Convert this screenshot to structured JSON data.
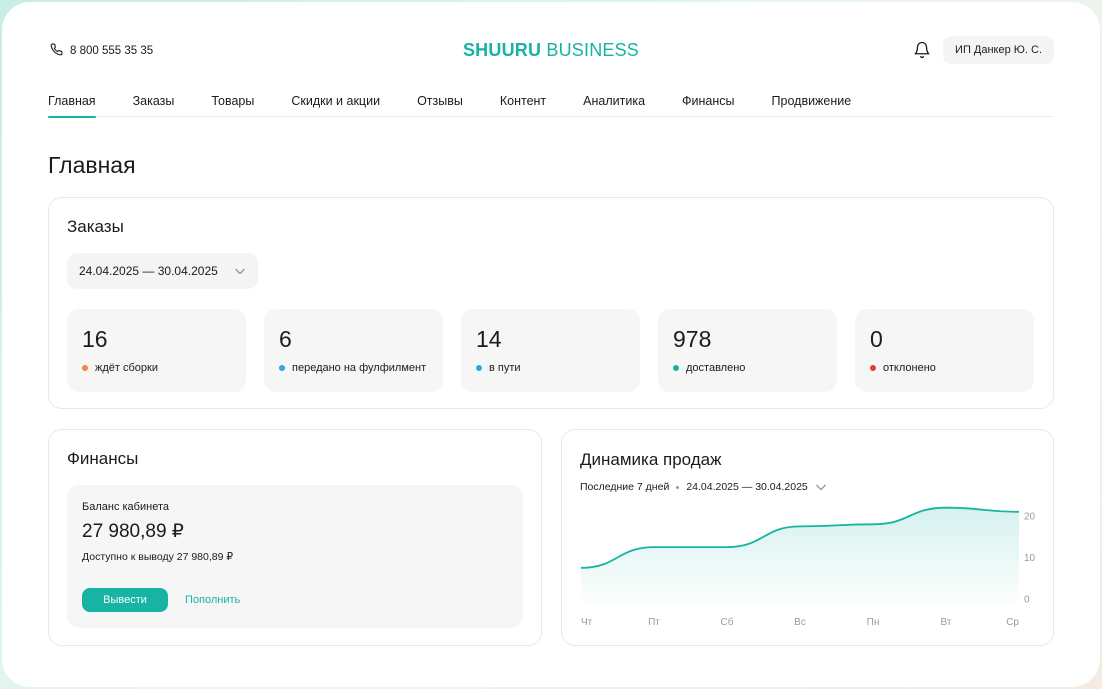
{
  "header": {
    "phone": "8 800 555 35 35",
    "logo_bold": "SHUURU",
    "logo_light": " BUSINESS",
    "account": "ИП Данкер Ю. С."
  },
  "nav": {
    "items": [
      "Главная",
      "Заказы",
      "Товары",
      "Скидки и акции",
      "Отзывы",
      "Контент",
      "Аналитика",
      "Финансы",
      "Продвижение"
    ],
    "active": "Главная"
  },
  "page_title": "Главная",
  "orders": {
    "title": "Заказы",
    "date_range": "24.04.2025 — 30.04.2025",
    "stats": [
      {
        "value": "16",
        "label": "ждёт сборки",
        "color": "#f5883b"
      },
      {
        "value": "6",
        "label": "передано на фулфилмент",
        "color": "#2fa6e8"
      },
      {
        "value": "14",
        "label": "в пути",
        "color": "#2fa6e8"
      },
      {
        "value": "978",
        "label": "доставлено",
        "color": "#17b3a3"
      },
      {
        "value": "0",
        "label": "отклонено",
        "color": "#e53935"
      }
    ]
  },
  "finance": {
    "title": "Финансы",
    "balance_label": "Баланс кабинета",
    "balance_value": "27 980,89 ₽",
    "available": "Доступно к выводу 27 980,89 ₽",
    "withdraw_label": "Вывести",
    "topup_label": "Пополнить"
  },
  "sales": {
    "title": "Динамика продаж",
    "period_label": "Последние 7 дней",
    "period_range": "24.04.2025 — 30.04.2025"
  },
  "colors": {
    "accent": "#17b3a3"
  },
  "chart_data": {
    "type": "area",
    "categories": [
      "Чт",
      "Пт",
      "Сб",
      "Вс",
      "Пн",
      "Вт",
      "Ср"
    ],
    "values": [
      7.5,
      12.5,
      12.5,
      17.5,
      18,
      22,
      21
    ],
    "ylim": [
      0,
      20
    ],
    "yticks": [
      "0",
      "10",
      "20"
    ],
    "grid": false,
    "legend": "none"
  }
}
